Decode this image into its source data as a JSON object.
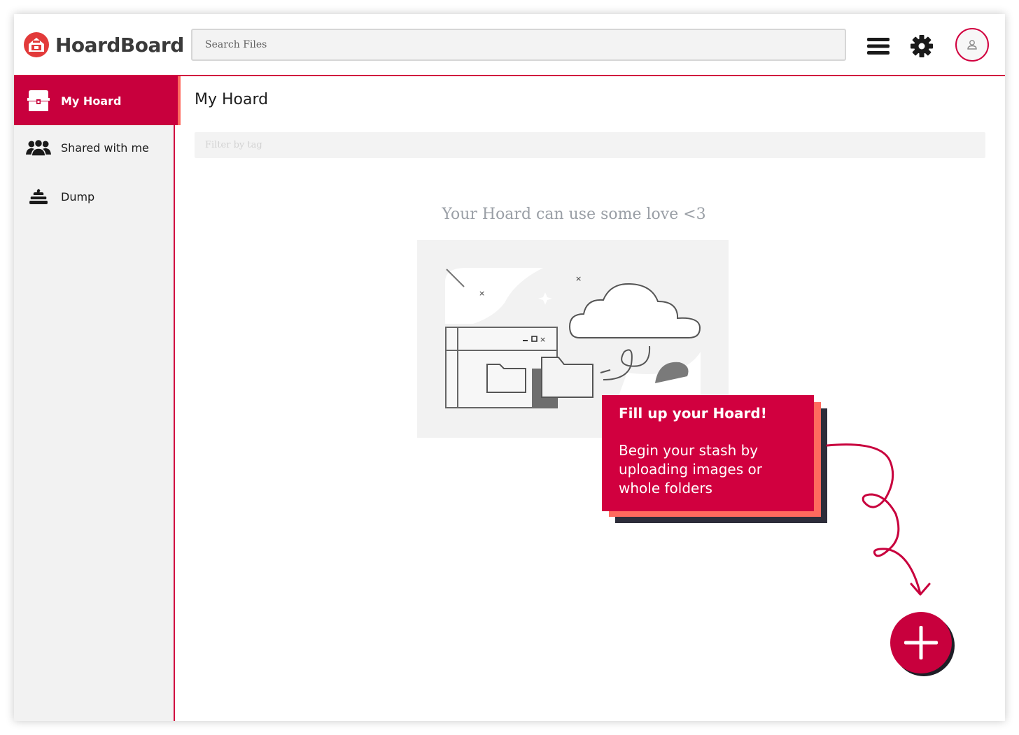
{
  "app": {
    "name": "HoardBoard",
    "accent_color": "#d1003f",
    "accent_secondary": "#ff6a5e",
    "dark_color": "#2d2d3a"
  },
  "header": {
    "search_placeholder": "Search Files",
    "icons": [
      "hamburger-menu-icon",
      "gear-icon",
      "user-avatar-icon"
    ]
  },
  "sidebar": {
    "items": [
      {
        "label": "My Hoard",
        "icon": "treasure-chest-icon",
        "active": true
      },
      {
        "label": "Shared with me",
        "icon": "group-users-icon",
        "active": false
      },
      {
        "label": "Dump",
        "icon": "pile-icon",
        "active": false
      }
    ]
  },
  "main": {
    "title": "My Hoard",
    "filter_placeholder": "Filter by tag",
    "empty_message": "Your Hoard can use some love <3"
  },
  "callout": {
    "title": "Fill up your Hoard!",
    "body": "Begin your stash by uploading images or whole folders"
  },
  "fab": {
    "icon": "plus-icon"
  }
}
